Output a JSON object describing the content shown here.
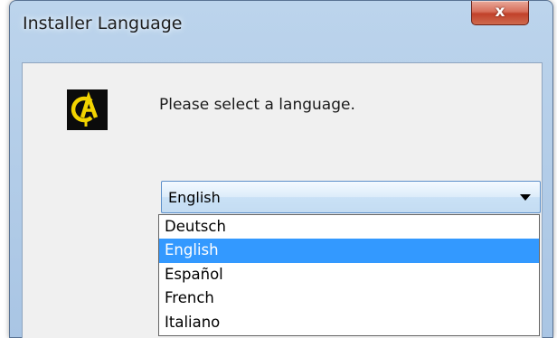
{
  "window": {
    "title": "Installer Language",
    "close_label": "x"
  },
  "dialog": {
    "prompt": "Please select a language.",
    "logo": "installer-logo",
    "selected_language": "English"
  },
  "dropdown": {
    "options": [
      "Deutsch",
      "English",
      "Español",
      "French",
      "Italiano"
    ],
    "highlighted": "English"
  },
  "colors": {
    "highlight": "#3399ff",
    "logo_accent": "#f2d300",
    "close_button": "#c9503a"
  },
  "icons": [
    "close-icon",
    "chevron-down-icon",
    "app-logo-icon"
  ]
}
